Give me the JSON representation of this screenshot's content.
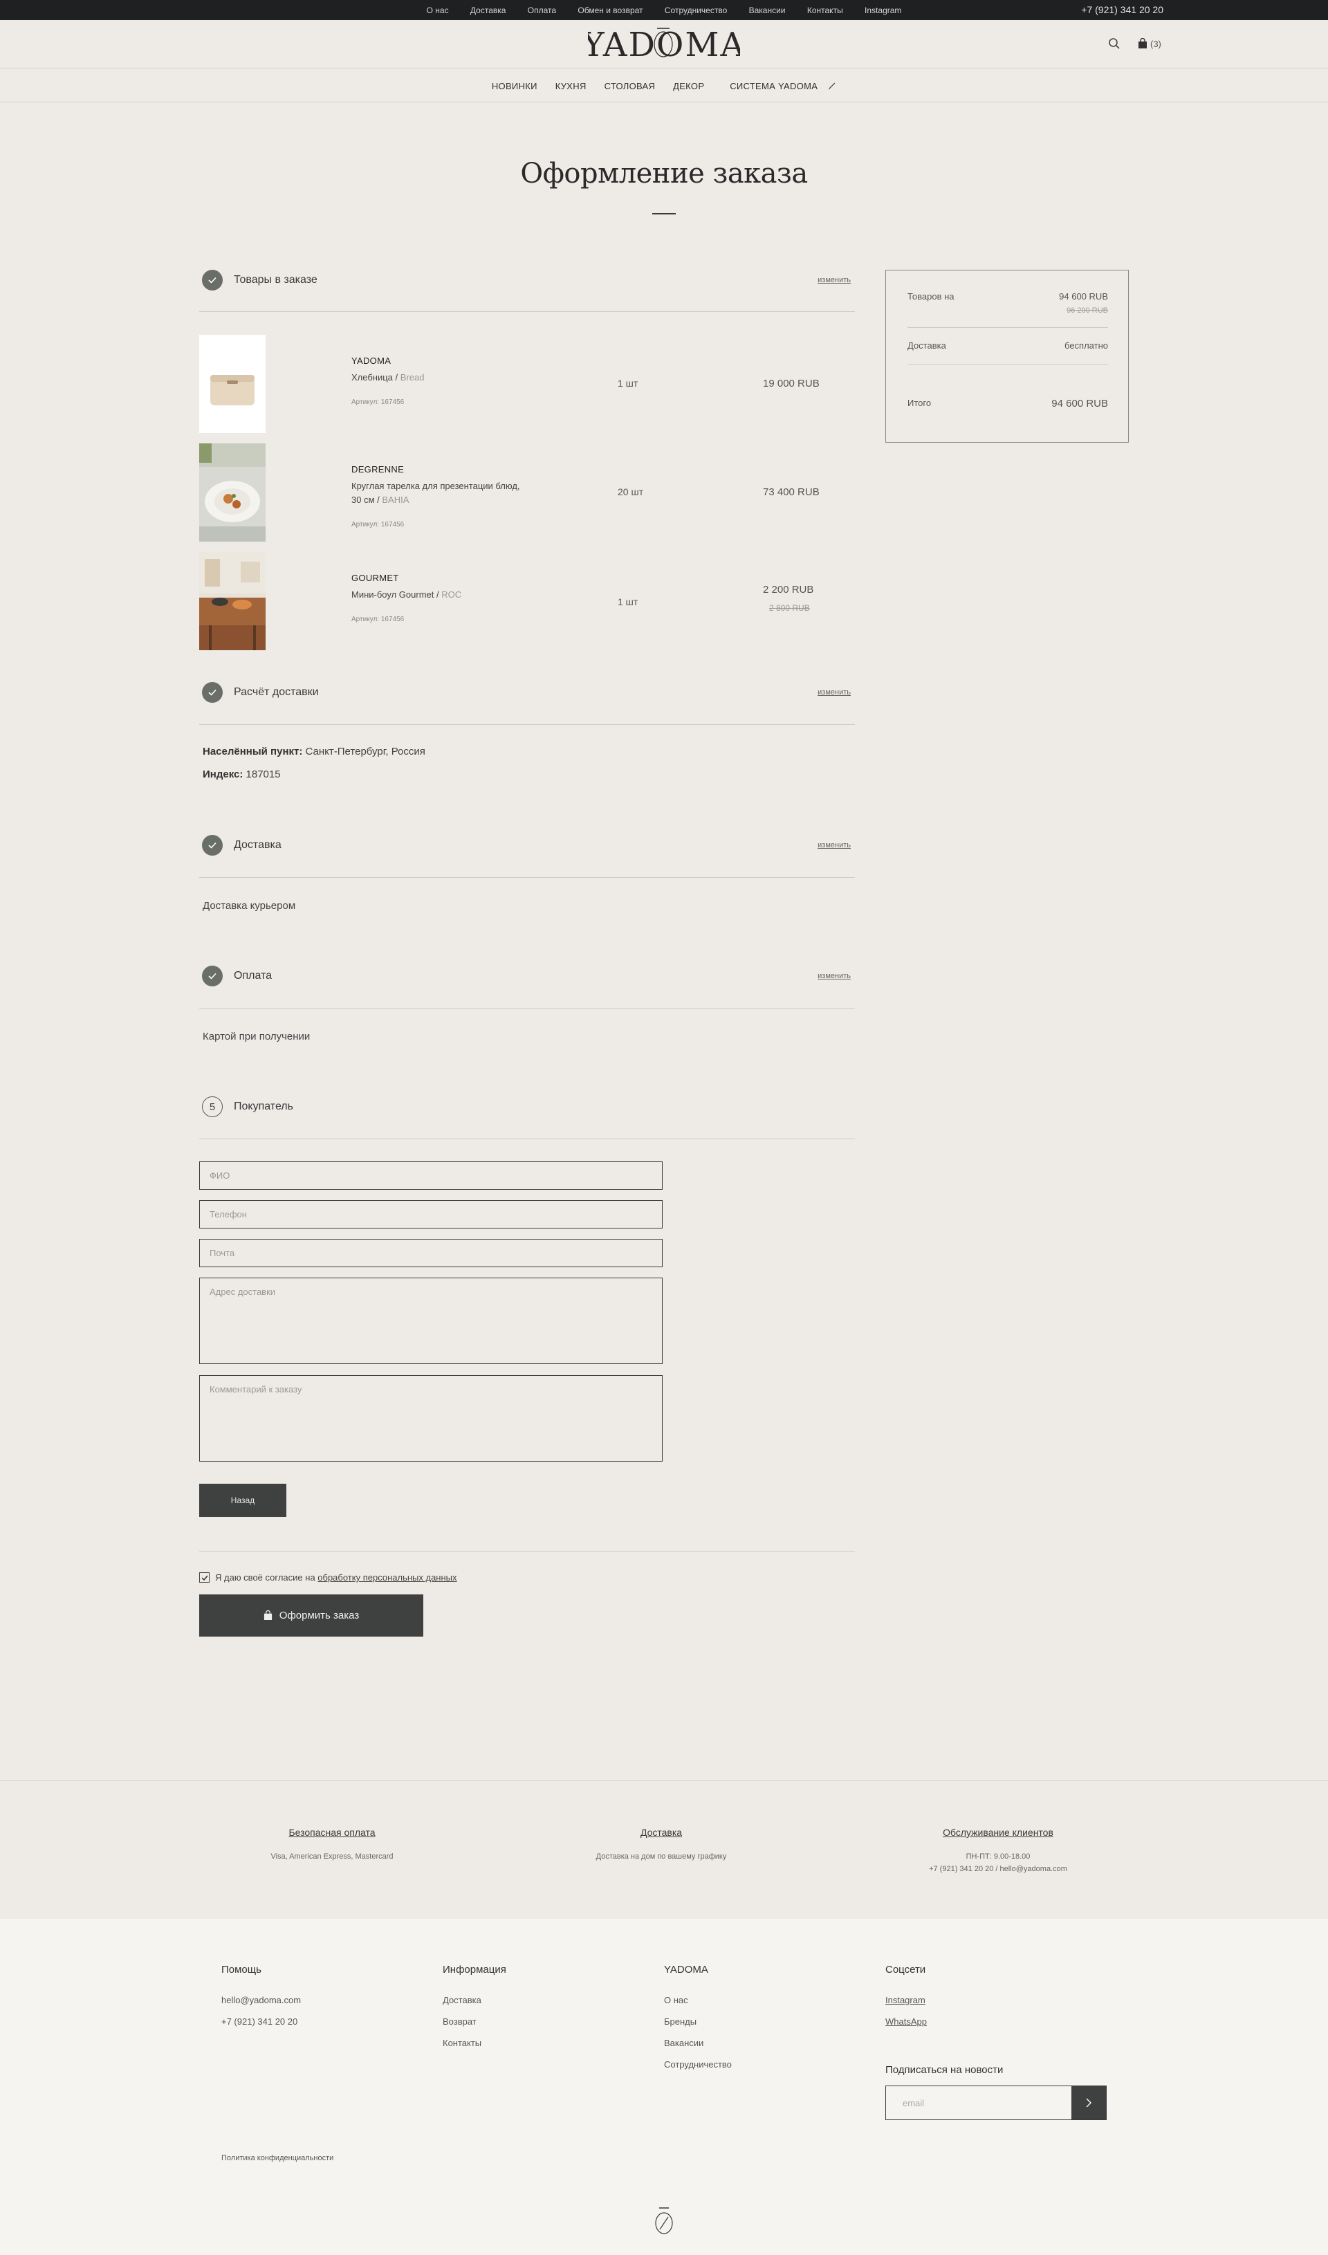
{
  "topbar": {
    "links": [
      "О нас",
      "Доставка",
      "Оплата",
      "Обмен и возврат",
      "Сотрудничество",
      "Вакансии",
      "Контакты",
      "Instagram"
    ],
    "phone": "+7 (921) 341 20 20"
  },
  "header": {
    "logo_text": "YADOMA",
    "cart_count": "(3)"
  },
  "catnav": [
    "НОВИНКИ",
    "КУХНЯ",
    "СТОЛОВАЯ",
    "ДЕКОР",
    "СИСТЕМА YADOMA"
  ],
  "page": {
    "title": "Оформление заказа"
  },
  "sections": {
    "items": {
      "title": "Товары в заказе",
      "edit": "изменить"
    },
    "calc": {
      "title": "Расчёт доставки",
      "edit": "изменить"
    },
    "delivery": {
      "title": "Доставка",
      "edit": "изменить",
      "value": "Доставка курьером"
    },
    "payment": {
      "title": "Оплата",
      "edit": "изменить",
      "value": "Картой при получении"
    },
    "buyer": {
      "num": "5",
      "title": "Покупатель"
    }
  },
  "products": [
    {
      "brand": "YADOMA",
      "name": "Хлебница / ",
      "sub": "Bread",
      "art": "Артикул: 167456",
      "qty": "1 шт",
      "price": "19 000 RUB",
      "old": ""
    },
    {
      "brand": "DEGRENNE",
      "name": "Круглая тарелка для презентации блюд, 30 см / ",
      "sub": "BAHIA",
      "art": "Артикул: 167456",
      "qty": "20 шт",
      "price": "73 400 RUB",
      "old": ""
    },
    {
      "brand": "GOURMET",
      "name": "Мини-боул Gourmet / ",
      "sub": "ROC",
      "art": "Артикул: 167456",
      "qty": "1 шт",
      "price": "2 200 RUB",
      "old": "2 800 RUB"
    }
  ],
  "calc_info": {
    "city_label": "Населённый пункт:",
    "city": "Санкт-Петербург, Россия",
    "index_label": "Индекс:",
    "index": "187015"
  },
  "summary": {
    "goods_label": "Товаров на",
    "goods_value": "94 600 RUB",
    "goods_old": "96 200 RUB",
    "delivery_label": "Доставка",
    "delivery_value": "бесплатно",
    "total_label": "Итого",
    "total_value": "94 600 RUB"
  },
  "form": {
    "name_ph": "ФИО",
    "phone_ph": "Телефон",
    "email_ph": "Почта",
    "address_ph": "Адрес доставки",
    "comment_ph": "Комментарий к заказу",
    "back": "Назад",
    "consent_text": "Я даю своё согласие на ",
    "consent_link": "обработку персональных данных",
    "submit": "Оформить заказ"
  },
  "benefits": [
    {
      "title": "Безопасная оплата",
      "desc": "Visa, American Express, Mastercard"
    },
    {
      "title": "Доставка",
      "desc": "Доставка на дом по вашему графику"
    },
    {
      "title": "Обслуживание клиентов",
      "desc": "ПН-ПТ: 9.00-18.00",
      "desc2": "+7 (921) 341 20 20 / hello@yadoma.com"
    }
  ],
  "footer": {
    "help": {
      "title": "Помощь",
      "items": [
        "hello@yadoma.com",
        "+7 (921) 341 20 20"
      ]
    },
    "info": {
      "title": "Информация",
      "items": [
        "Доставка",
        "Возврат",
        "Контакты"
      ]
    },
    "yadoma": {
      "title": "YADOMA",
      "items": [
        "О нас",
        "Бренды",
        "Вакансии",
        "Сотрудничество"
      ]
    },
    "social": {
      "title": "Соцсети",
      "items": [
        "Instagram",
        "WhatsApp"
      ]
    },
    "subscribe_title": "Подписаться на новости",
    "subscribe_ph": "email",
    "policy": "Политика конфиденциальности"
  },
  "colors": {
    "background": "#eeeae6",
    "dark": "#3f4140",
    "topbar": "#1f2021",
    "footer": "#f6f4f0"
  },
  "icons": [
    "search-icon",
    "bag-icon",
    "pen-icon",
    "check-icon",
    "chevron-right-icon",
    "logo-mark-icon"
  ]
}
